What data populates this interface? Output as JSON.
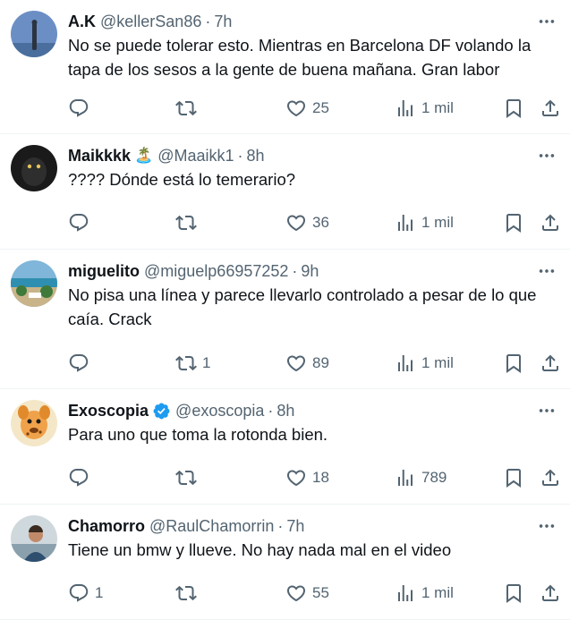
{
  "tweets": [
    {
      "name": "A.K",
      "handle": "@kellerSan86",
      "time": "7h",
      "text": "No se puede tolerar esto. Mientras en Barcelona DF volando la tapa de los sesos a la gente de buena mañana. Gran labor",
      "replies": "",
      "retweets": "",
      "likes": "25",
      "views": "1 mil"
    },
    {
      "name": "Maikkkk",
      "emoji": "🏝️",
      "handle": "@Maaikk1",
      "time": "8h",
      "text": "???? Dónde está lo temerario?",
      "replies": "",
      "retweets": "",
      "likes": "36",
      "views": "1 mil"
    },
    {
      "name": "miguelito",
      "handle": "@miguelp66957252",
      "time": "9h",
      "text": "No pisa una línea y parece llevarlo controlado a pesar de lo que caía. Crack",
      "replies": "",
      "retweets": "1",
      "likes": "89",
      "views": "1 mil"
    },
    {
      "name": "Exoscopia",
      "verified": true,
      "handle": "@exoscopia",
      "time": "8h",
      "text": "Para uno que toma la rotonda bien.",
      "replies": "",
      "retweets": "",
      "likes": "18",
      "views": "789"
    },
    {
      "name": "Chamorro",
      "handle": "@RaulChamorrin",
      "time": "7h",
      "text": "Tiene un bmw y llueve. No hay nada mal en el video",
      "replies": "1",
      "retweets": "",
      "likes": "55",
      "views": "1 mil"
    }
  ],
  "separator": "·",
  "colors": {
    "text": "#0f1419",
    "secondary": "#536471",
    "divider": "#eff3f4",
    "verified": "#1d9bf0"
  },
  "icons": [
    "reply-icon",
    "retweet-icon",
    "like-icon",
    "views-icon",
    "bookmark-icon",
    "share-icon",
    "more-icon",
    "verified-badge-icon"
  ]
}
